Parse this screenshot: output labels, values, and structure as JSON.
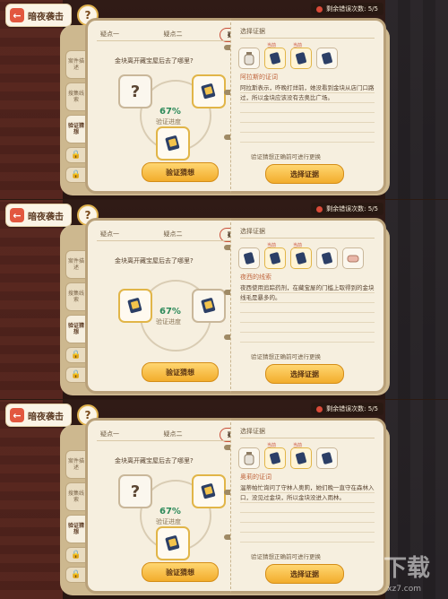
{
  "common": {
    "back_label": "暗夜袭击",
    "help_label": "?",
    "errors_text": "剩余错误次数: 5/5",
    "question_tabs": [
      "疑点一",
      "疑点二",
      "疑点三"
    ],
    "side_tabs": [
      "案件描述",
      "搜集线索",
      "验证猜想"
    ],
    "lock_glyph": "🔒",
    "question": "金块离开藏宝屋后去了哪里?",
    "progress": "67%",
    "progress_label": "验证进度",
    "verify_button": "验证猜想",
    "select_header": "选择证据",
    "hint": "验证猜想正确前可进行更换",
    "select_button": "选择证据",
    "current_tag": "当前",
    "question_mark": "?"
  },
  "panels": [
    {
      "evidence_title": "阿拉斯的证词",
      "evidence_desc": "阿拉斯表示，昨晚打烊前，她没看到金块从店门口路过，所以金块应该没有去奥比广场。"
    },
    {
      "evidence_title": "夜西的线索",
      "evidence_desc": "夜西使用追踪药剂，在藏宝屋的门槛上取得到的金块线毛是暴多的。"
    },
    {
      "evidence_title": "奥莉的证词",
      "evidence_desc": "温蒂帕忙询问了守林人奥莉，她们晚一直守在森林入口，没见过金块，所以金块没进入雨林。"
    }
  ],
  "watermark": {
    "main": "下载",
    "sub": "xz7.com"
  }
}
